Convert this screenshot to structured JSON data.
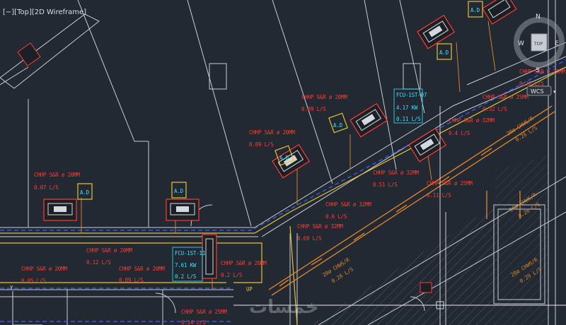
{
  "viewport": {
    "label": "[−][Top][2D Wireframe]"
  },
  "viewcube": {
    "north": "N",
    "south": "S",
    "east": "E",
    "west": "W",
    "face": "TOP",
    "wcs": "WCS"
  },
  "colors": {
    "background": "#222933",
    "duct_label": "#ff3b30",
    "fcu_label": "#2fe6ff",
    "chws": "#d9822b",
    "wall": "#c8cdd4",
    "blue_dash": "#3c64ff"
  },
  "ducts": [
    {
      "size": "CHHP S&R ø 20MM",
      "flow": "0.07 L/S"
    },
    {
      "size": "CHHP S&R ø 20MM",
      "flow": "0.09 L/S"
    },
    {
      "size": "CHHP S&R ø 20MM",
      "flow": "0.09 L/S"
    },
    {
      "size": "CHHP S&R ø 20MM",
      "flow": "0.12 L/S"
    },
    {
      "size": "CHHP S&R ø 20MM",
      "flow": "0.05 L/S"
    },
    {
      "size": "CHHP S&R ø 20MM",
      "flow": "0.09 L/S"
    },
    {
      "size": "CHHP S&R ø 20MM",
      "flow": "0.2 L/S"
    },
    {
      "size": "CHHP S&R ø 32MM",
      "flow": "0.51 L/S"
    },
    {
      "size": "CHHP S&R ø 32MM",
      "flow": "0.6 L/S"
    },
    {
      "size": "CHHP S&R ø 32MM",
      "flow": "0.69 L/S"
    },
    {
      "size": "CHHP S&R ø 25MM",
      "flow": "0.11 L/S"
    },
    {
      "size": "CHHP S&R ø 32MM",
      "flow": "0.4 L/S"
    },
    {
      "size": "CHHP S&R ø 25MM",
      "flow": "0.32 L/S"
    },
    {
      "size": "CHHP S&R ø 25MM",
      "flow": "0.22 L/S"
    },
    {
      "size": "CHHP S&R ø 25MM",
      "flow": "0.14 L/S"
    }
  ],
  "fcus": [
    {
      "tag": "FCU-1ST-07",
      "kw": "4.17 KW",
      "flow": "0.11 L/S"
    },
    {
      "tag": "FCU-1ST-11",
      "kw": "7.61 KW",
      "flow": "0.2 L/S"
    }
  ],
  "chws": [
    {
      "text": "20ø CHWS/R",
      "flow": "0.26 L/S"
    },
    {
      "text": "20ø CHWS/R",
      "flow": "0.26 L/S"
    },
    {
      "text": "20ø CHWS/R",
      "flow": "0.26 L/S"
    },
    {
      "text": "20ø CHWS/R",
      "flow": "0.29 L/S"
    }
  ],
  "tags": {
    "ad": "A.D",
    "up": "UP",
    "y_axis": "Y"
  },
  "watermark": "خمسات"
}
